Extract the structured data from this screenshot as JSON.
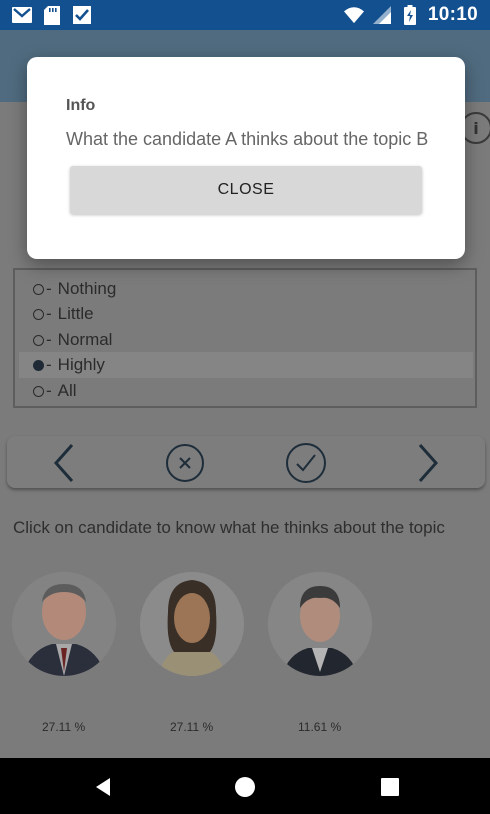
{
  "status_bar": {
    "time": "10:10",
    "left_icons": [
      "gmail-icon",
      "sd-card-icon",
      "tasks-icon"
    ],
    "right_icons": [
      "wifi-icon",
      "signal-icon",
      "battery-icon"
    ]
  },
  "question": {
    "options": [
      {
        "label": "Nothing",
        "selected": false
      },
      {
        "label": "Little",
        "selected": false
      },
      {
        "label": "Normal",
        "selected": false
      },
      {
        "label": "Highly",
        "selected": true
      },
      {
        "label": "All",
        "selected": false
      }
    ]
  },
  "navigation": {
    "prev_icon": "chevron-left-icon",
    "clear_icon": "close-circle-icon",
    "confirm_icon": "check-circle-icon",
    "next_icon": "chevron-right-icon"
  },
  "hint_text": "Click on candidate to know what he thinks about the topic",
  "candidates": [
    {
      "percent": "27.11 %"
    },
    {
      "percent": "27.11 %"
    },
    {
      "percent": "11.61 %"
    }
  ],
  "dialog": {
    "title": "Info",
    "message": "What the candidate A thinks about the topic B",
    "button_label": "CLOSE"
  },
  "colors": {
    "status_bar": "#12508f",
    "app_bar_dimmed": "#506b7f",
    "content_dimmed": "#7b7b7b"
  }
}
